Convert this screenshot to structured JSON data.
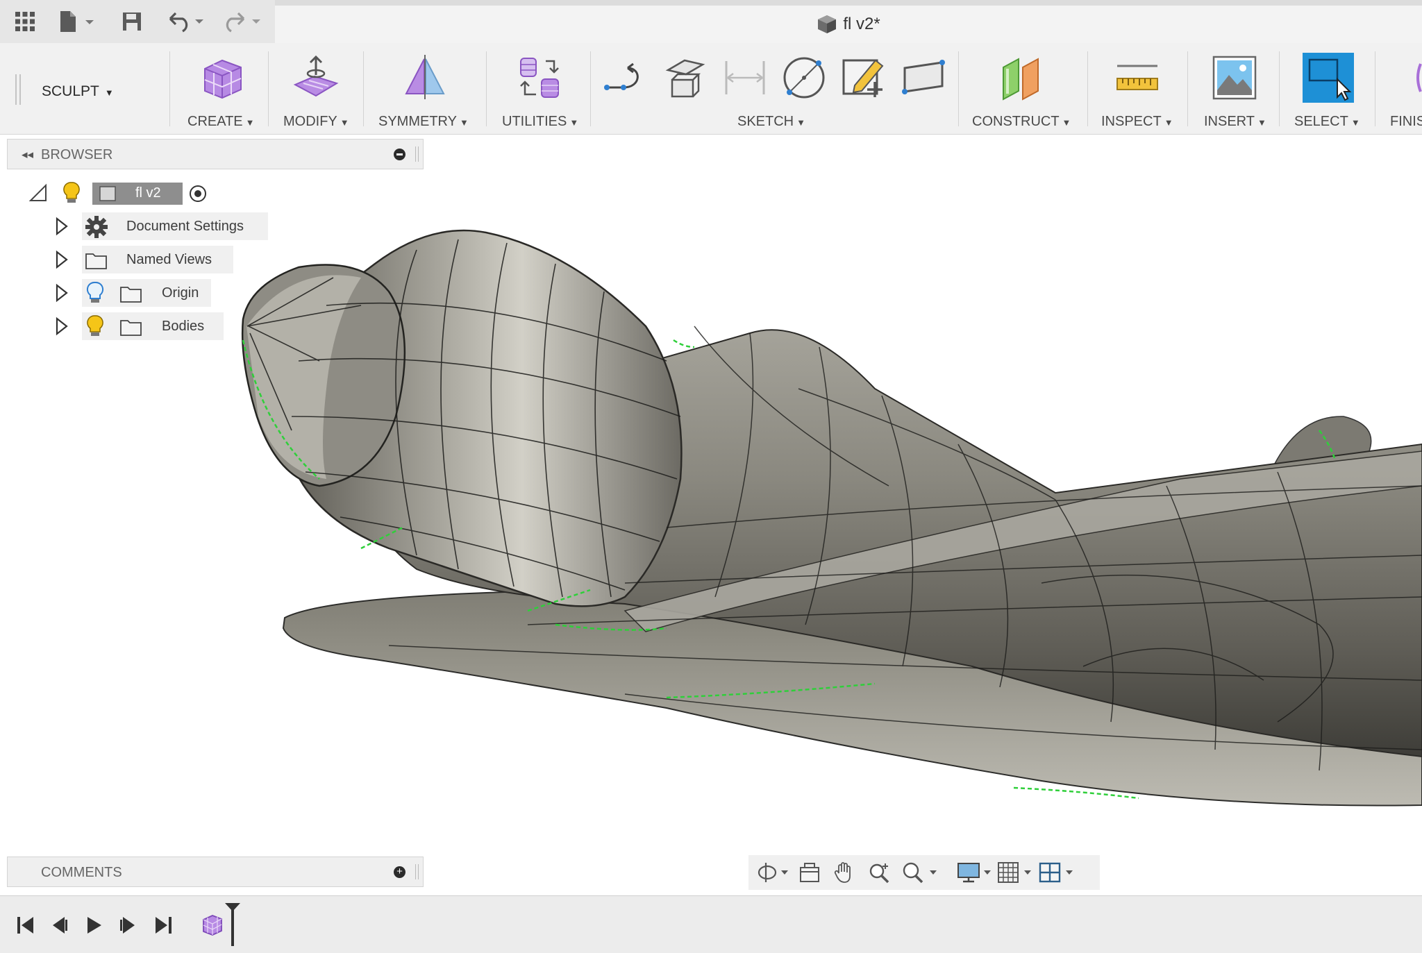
{
  "document": {
    "title": "fl v2*"
  },
  "quick_access": {
    "icons": [
      "app-grid-icon",
      "file-icon",
      "save-icon",
      "undo-icon",
      "redo-icon"
    ]
  },
  "toolbar": {
    "workspace": "SCULPT",
    "groups": [
      {
        "label": "CREATE",
        "icon": "create-form-icon"
      },
      {
        "label": "MODIFY",
        "icon": "modify-form-icon"
      },
      {
        "label": "SYMMETRY",
        "icon": "symmetry-icon"
      },
      {
        "label": "UTILITIES",
        "icon": "utilities-icon"
      },
      {
        "label": "SKETCH",
        "icon": "sketch-icon"
      },
      {
        "label": "CONSTRUCT",
        "icon": "construct-plane-icon"
      },
      {
        "label": "INSPECT",
        "icon": "measure-icon"
      },
      {
        "label": "INSERT",
        "icon": "insert-image-icon"
      },
      {
        "label": "SELECT",
        "icon": "select-icon"
      },
      {
        "label": "FINIS",
        "icon": "finish-form-icon"
      }
    ]
  },
  "browser": {
    "title": "BROWSER",
    "root": {
      "label": "fl v2"
    },
    "items": [
      {
        "label": "Document Settings",
        "icon": "gear-icon"
      },
      {
        "label": "Named Views",
        "icon": "folder-icon"
      },
      {
        "label": "Origin",
        "icon": "folder-icon",
        "visibility": "hidden-bulb"
      },
      {
        "label": "Bodies",
        "icon": "folder-icon",
        "visibility": "visible-bulb"
      }
    ]
  },
  "comments": {
    "title": "COMMENTS"
  },
  "navbar": {
    "icons": [
      "orbit-icon",
      "look-at-icon",
      "pan-icon",
      "zoom-icon",
      "zoom-window-icon",
      "display-settings-icon",
      "grid-icon",
      "viewports-icon"
    ]
  },
  "timeline": {
    "icons": [
      "first-icon",
      "previous-icon",
      "play-icon",
      "next-icon",
      "last-icon",
      "form-feature-icon"
    ]
  },
  "colors": {
    "accent": "#1e90d6",
    "form_purple": "#a86fd8",
    "body": "#76746c",
    "edge_green": "#2fcf3a"
  }
}
